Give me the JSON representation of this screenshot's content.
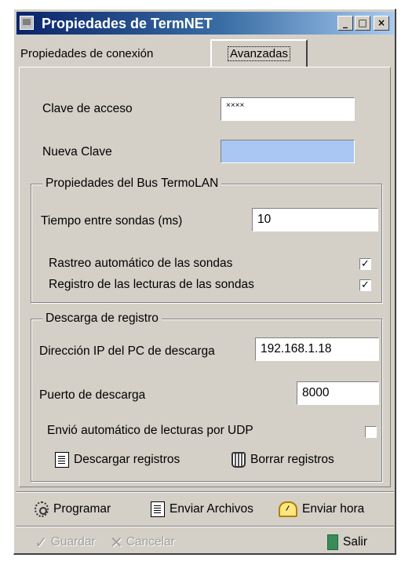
{
  "window": {
    "title": "Propiedades de TermNET",
    "controls": {
      "minimize": "_",
      "maximize": "□",
      "close": "×"
    }
  },
  "tabs": [
    {
      "label": "Propiedades de conexión",
      "active": false
    },
    {
      "label": "Avanzadas",
      "active": true
    }
  ],
  "access": {
    "password_label": "Clave de acceso",
    "password_value": "××××",
    "new_password_label": "Nueva Clave",
    "new_password_value": ""
  },
  "bus": {
    "legend": "Propiedades del Bus TermoLAN",
    "interval_label": "Tiempo entre sondas (ms)",
    "interval_value": "10",
    "auto_scan_label": "Rastreo automático de las sondas",
    "auto_scan_checked": true,
    "log_readings_label": "Registro de las lecturas de las sondas",
    "log_readings_checked": true
  },
  "download": {
    "legend": "Descarga de registro",
    "ip_label": "Dirección IP del PC de descarga",
    "ip_value": "192.168.1.18",
    "port_label": "Puerto de descarga",
    "port_value": "8000",
    "udp_label": "Envió automático de lecturas por UDP",
    "udp_checked": false,
    "download_button": "Descargar registros",
    "delete_button": "Borrar registros"
  },
  "toolbar": {
    "program": "Programar",
    "send_files": "Enviar Archivos",
    "send_time": "Enviar hora"
  },
  "footer": {
    "save": "Guardar",
    "cancel": "Cancelar",
    "exit": "Salir"
  },
  "icons": {
    "window": "app-icon",
    "download": "document-icon",
    "delete": "trash-icon",
    "program": "gear-icon",
    "send_files": "document-icon",
    "send_time": "clock-icon",
    "save": "check-icon",
    "cancel": "x-icon",
    "exit": "door-icon"
  },
  "colors": {
    "face": "#d4d0c8",
    "title_start": "#0a246a",
    "title_end": "#a6caf0",
    "new_password_field": "#a9c7f2"
  }
}
